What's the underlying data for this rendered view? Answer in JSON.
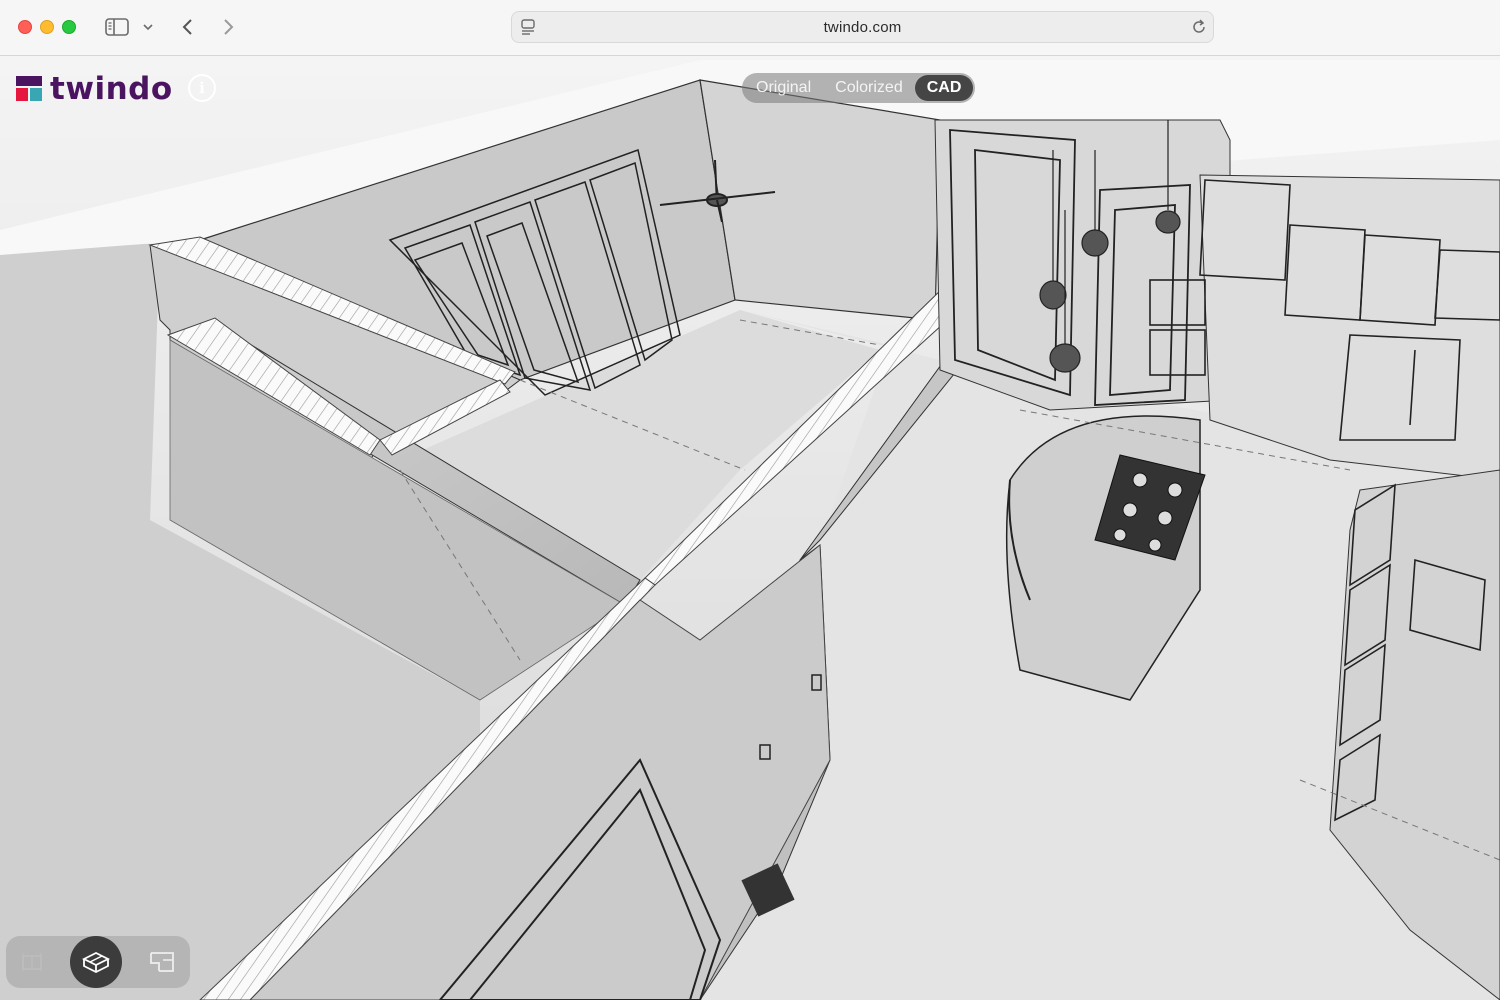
{
  "browser": {
    "url": "twindo.com"
  },
  "app": {
    "logo_text": "twindo",
    "info_icon": "info-icon"
  },
  "view_modes": {
    "items": [
      "Original",
      "Colorized",
      "CAD"
    ],
    "selected": "CAD"
  },
  "view_toolbar": {
    "buttons": [
      "floorplan-icon",
      "3d-dollhouse-icon",
      "2d-plan-icon"
    ],
    "selected": "3d-dollhouse-icon"
  },
  "colors": {
    "brand": "#4a1460",
    "logo_red": "#e5173f",
    "logo_teal": "#39a7b3"
  }
}
